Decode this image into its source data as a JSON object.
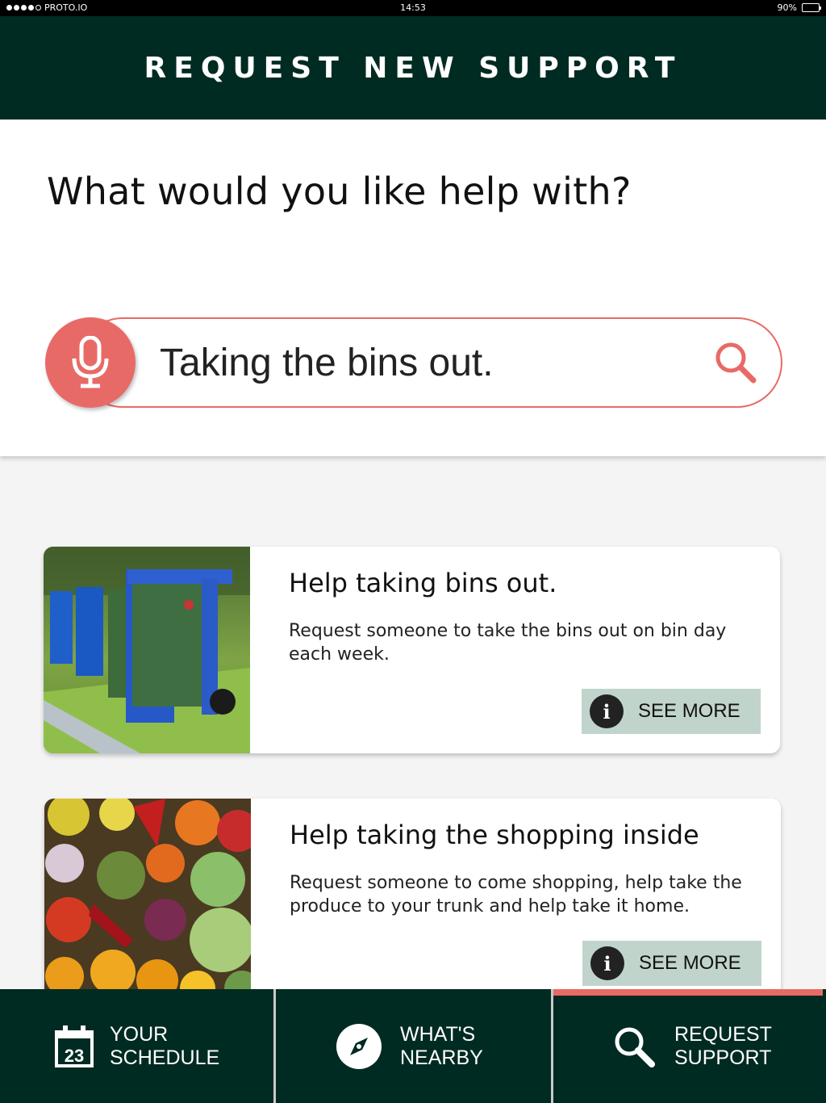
{
  "status_bar": {
    "carrier": "PROTO.IO",
    "time": "14:53",
    "battery": "90%",
    "battery_level": 0.9
  },
  "header": {
    "title": "REQUEST NEW SUPPORT"
  },
  "query": {
    "question": "What would you like help with?",
    "search_value": "Taking the bins out."
  },
  "results": [
    {
      "title": "Help taking bins out.",
      "description": "Request someone to take the bins out on bin day each week.",
      "button_label": "SEE MORE",
      "image": "wheelie-bins-photo"
    },
    {
      "title": "Help taking the shopping inside",
      "description": "Request someone to come shopping, help take the produce to your trunk and help take it home.",
      "button_label": "SEE MORE",
      "image": "fresh-produce-photo"
    }
  ],
  "nav": {
    "items": [
      {
        "label": "YOUR\nSCHEDULE",
        "icon": "calendar-icon",
        "calendar_day": "23"
      },
      {
        "label": "WHAT'S\nNEARBY",
        "icon": "compass-icon"
      },
      {
        "label": "REQUEST\nSUPPORT",
        "icon": "search-icon",
        "active": true
      }
    ]
  },
  "colors": {
    "brand_dark_green": "#002b22",
    "accent_coral": "#e86a66",
    "button_sage": "#c1d4cc"
  }
}
